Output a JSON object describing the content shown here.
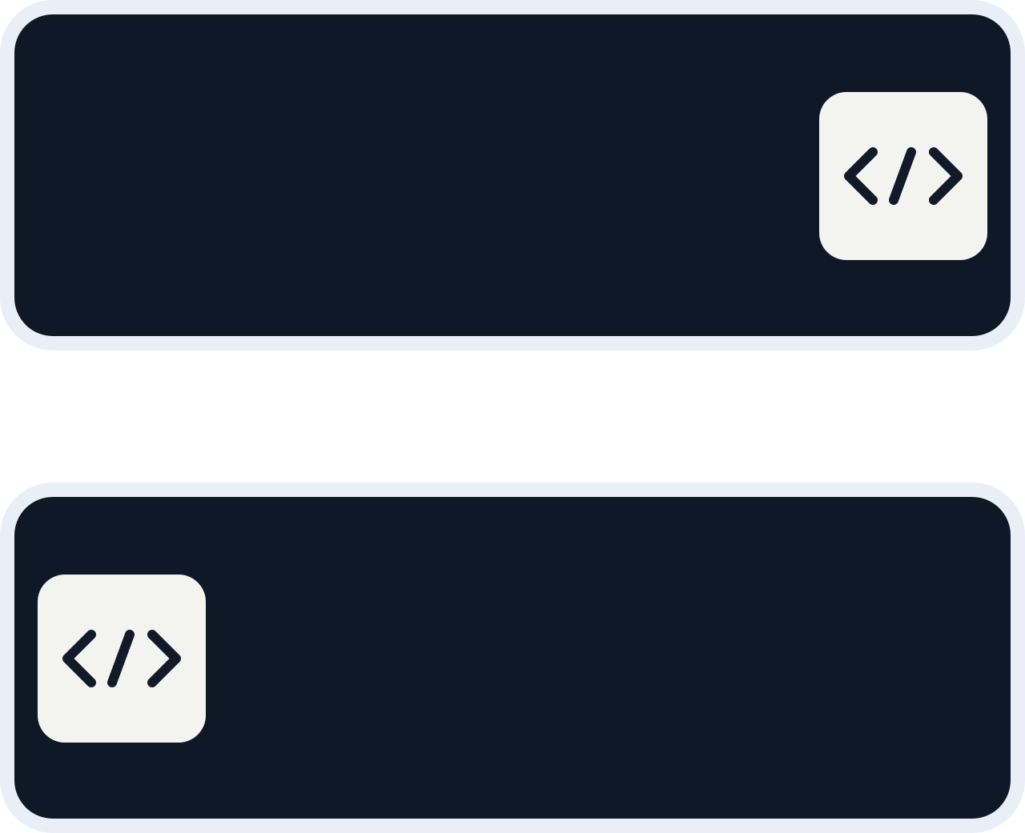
{
  "colors": {
    "page_background": "#ffffff",
    "panel_border": "#eaeff7",
    "panel_fill": "#0f1827",
    "tile_fill": "#f3f4ef",
    "glyph": "#121a2a"
  },
  "panels": [
    {
      "icon": "code-icon",
      "tile_alignment": "right"
    },
    {
      "icon": "code-icon",
      "tile_alignment": "left"
    }
  ]
}
